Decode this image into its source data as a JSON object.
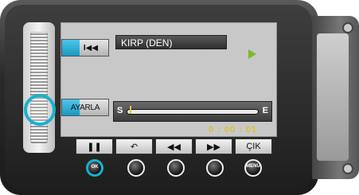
{
  "screen": {
    "title": "KIRP (DEN)",
    "adjust_label": "AYARLA",
    "skip_glyph": "I◀◀",
    "track_start_label": "S",
    "track_end_label": "E",
    "track_progress": 0.02,
    "time": "0 : 00 : 01"
  },
  "toolbar": {
    "buttons": [
      {
        "glyph": "❚❚"
      },
      {
        "glyph": "↶"
      },
      {
        "glyph": "◀◀"
      },
      {
        "glyph": "▶▶"
      },
      {
        "label": "ÇIK"
      }
    ]
  },
  "physical_buttons": [
    {
      "label": "OK"
    },
    {
      "label": ""
    },
    {
      "label": ""
    },
    {
      "label": ""
    },
    {
      "label": "MENU"
    }
  ],
  "colors": {
    "accent": "#1ab0d0",
    "play": "#7db82b",
    "time": "#d8c22a"
  }
}
